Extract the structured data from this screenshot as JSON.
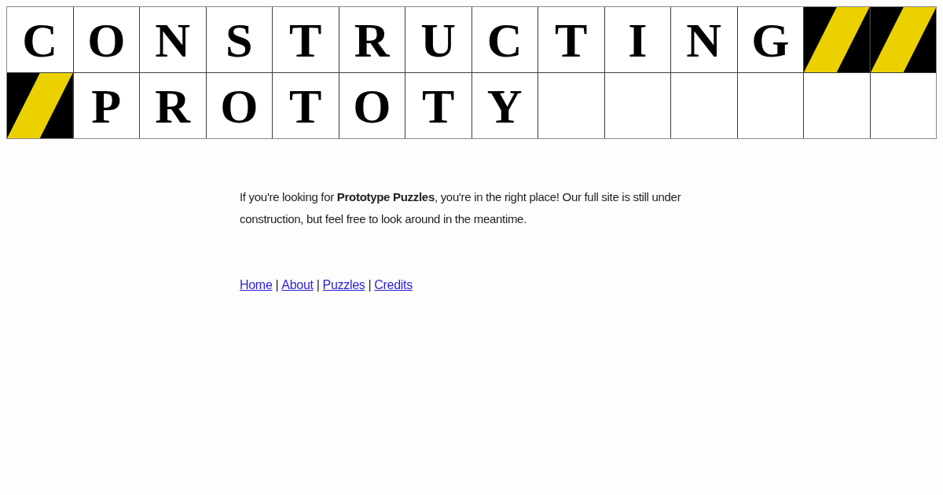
{
  "banner": {
    "rows": [
      {
        "cells": [
          {
            "kind": "letter",
            "text": "C"
          },
          {
            "kind": "letter",
            "text": "O"
          },
          {
            "kind": "letter",
            "text": "N"
          },
          {
            "kind": "letter",
            "text": "S"
          },
          {
            "kind": "letter",
            "text": "T"
          },
          {
            "kind": "letter",
            "text": "R"
          },
          {
            "kind": "letter",
            "text": "U"
          },
          {
            "kind": "letter",
            "text": "C"
          },
          {
            "kind": "letter",
            "text": "T"
          },
          {
            "kind": "letter",
            "text": "I"
          },
          {
            "kind": "letter",
            "text": "N"
          },
          {
            "kind": "letter",
            "text": "G"
          },
          {
            "kind": "hazard"
          },
          {
            "kind": "hazard"
          }
        ]
      },
      {
        "cells": [
          {
            "kind": "hazard"
          },
          {
            "kind": "letter",
            "text": "P"
          },
          {
            "kind": "letter",
            "text": "R"
          },
          {
            "kind": "letter",
            "text": "O"
          },
          {
            "kind": "letter",
            "text": "T"
          },
          {
            "kind": "letter",
            "text": "O"
          },
          {
            "kind": "letter",
            "text": "T"
          },
          {
            "kind": "letter",
            "text": "Y"
          },
          {
            "kind": "empty"
          },
          {
            "kind": "empty"
          },
          {
            "kind": "empty"
          },
          {
            "kind": "empty"
          },
          {
            "kind": "empty"
          },
          {
            "kind": "empty"
          }
        ]
      }
    ]
  },
  "intro": "If you're looking for **Prototype Puzzles**, you're in the right place! Our full site is still under construction, but feel free to look around in the meantime.",
  "nav": [
    {
      "kind": "link",
      "text": "Home"
    },
    {
      "kind": "separator",
      "text": "|"
    },
    {
      "kind": "link",
      "text": "About"
    },
    {
      "kind": "separator",
      "text": "|"
    },
    {
      "kind": "link",
      "text": "Puzzles"
    },
    {
      "kind": "separator",
      "text": "|"
    },
    {
      "kind": "link",
      "text": "Credits"
    }
  ]
}
